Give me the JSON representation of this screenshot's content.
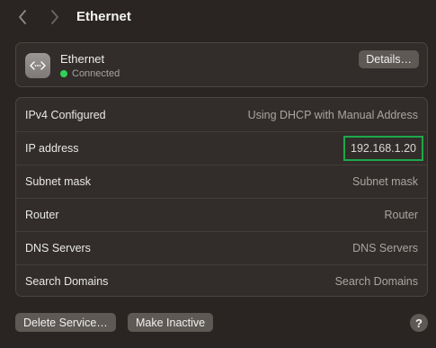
{
  "window": {
    "title": "Ethernet"
  },
  "service": {
    "name": "Ethernet",
    "status": "Connected",
    "status_color": "#30d158",
    "icon": "ethernet-icon",
    "details_label": "Details…"
  },
  "rows": [
    {
      "label": "IPv4 Configured",
      "value": "Using DHCP with Manual Address"
    },
    {
      "label": "IP address",
      "value": "192.168.1.20",
      "highlight_color": "#1ea84a"
    },
    {
      "label": "Subnet mask",
      "value": "Subnet mask"
    },
    {
      "label": "Router",
      "value": "Router"
    },
    {
      "label": "DNS Servers",
      "value": "DNS Servers"
    },
    {
      "label": "Search Domains",
      "value": "Search Domains"
    }
  ],
  "footer": {
    "delete_label": "Delete Service…",
    "inactive_label": "Make Inactive",
    "help_label": "?"
  }
}
